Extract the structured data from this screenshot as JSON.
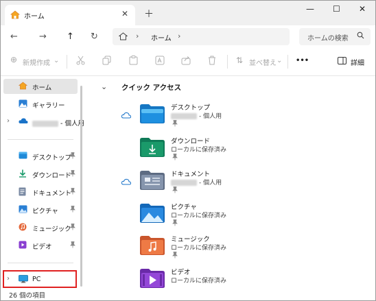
{
  "tab": {
    "title": "ホーム",
    "close": "✕",
    "new_tab": "＋"
  },
  "window_controls": {
    "minimize": "—",
    "maximize": "☐",
    "close": "✕"
  },
  "nav": {
    "back": "←",
    "forward": "→",
    "up": "↑",
    "refresh": "↻"
  },
  "address": {
    "separator": "›",
    "location": "ホーム"
  },
  "search": {
    "placeholder": "ホームの検索"
  },
  "toolbar": {
    "new_label": "新規作成",
    "sort_label": "並べ替え",
    "more_label": "•••",
    "details_label": "詳細"
  },
  "sidebar": {
    "items": [
      {
        "label": "ホーム",
        "icon": "home-icon"
      },
      {
        "label": "ギャラリー",
        "icon": "gallery-icon"
      },
      {
        "label": "- 個人用",
        "icon": "onedrive-cloud-icon"
      },
      {
        "label": "デスクトップ",
        "icon": "desktop-folder-icon"
      },
      {
        "label": "ダウンロード",
        "icon": "download-icon"
      },
      {
        "label": "ドキュメント",
        "icon": "documents-icon"
      },
      {
        "label": "ピクチャ",
        "icon": "pictures-icon"
      },
      {
        "label": "ミュージック",
        "icon": "music-icon"
      },
      {
        "label": "ビデオ",
        "icon": "video-icon"
      },
      {
        "label": "PC",
        "icon": "pc-monitor-icon"
      }
    ]
  },
  "quick_access": {
    "title": "クイック アクセス",
    "items": [
      {
        "name": "デスクトップ",
        "sub": "- 個人用",
        "icon": "desktop-folder-icon"
      },
      {
        "name": "ダウンロード",
        "sub": "ローカルに保存済み",
        "icon": "download-folder-icon"
      },
      {
        "name": "ドキュメント",
        "sub": "- 個人用",
        "icon": "documents-folder-icon"
      },
      {
        "name": "ピクチャ",
        "sub": "ローカルに保存済み",
        "icon": "pictures-folder-icon"
      },
      {
        "name": "ミュージック",
        "sub": "ローカルに保存済み",
        "icon": "music-folder-icon"
      },
      {
        "name": "ビデオ",
        "sub": "ローカルに保存済み",
        "icon": "video-folder-icon"
      }
    ]
  },
  "status": {
    "item_count": "26 個の項目"
  },
  "colors": {
    "highlight_border": "#e02020",
    "selected_bg": "#e5e5e5",
    "accent_blue": "#1a73c8"
  }
}
